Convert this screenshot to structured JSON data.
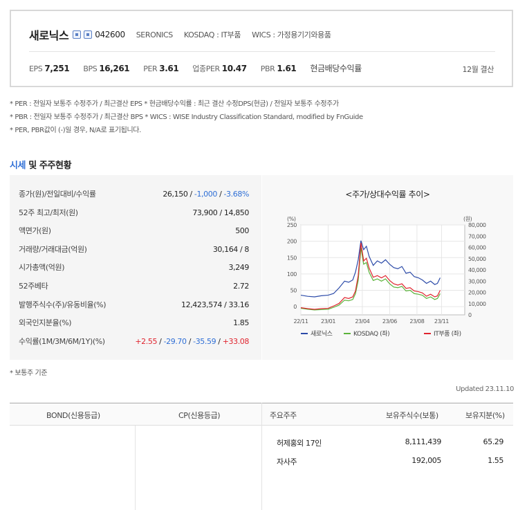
{
  "company": {
    "name": "새로닉스",
    "code": "042600",
    "english_name": "SERONICS",
    "market": "KOSDAQ : IT부품",
    "wics": "WICS : 가정용기기와용품",
    "ratios": [
      {
        "label": "EPS",
        "value": "7,251"
      },
      {
        "label": "BPS",
        "value": "16,261"
      },
      {
        "label": "PER",
        "value": "3.61"
      },
      {
        "label": "업종PER",
        "value": "10.47"
      },
      {
        "label": "PBR",
        "value": "1.61"
      }
    ],
    "cash_dividend_label": "현금배당수익률",
    "fiscal": "12월 결산"
  },
  "notes": [
    "* PER : 전일자 보통주 수정주가 / 최근결산 EPS * 현금배당수익률 : 최근 결산 수정DPS(현금) / 전일자 보통주 수정주가",
    "* PBR : 전일자 보통주 수정주가 / 최근결산 BPS * WICS : WISE Industry Classification Standard, modified by FnGuide",
    "* PER, PBR값이 (-)일 경우, N/A로 표기됩니다."
  ],
  "section": {
    "accent": "시세",
    "rest": " 및 주주현황"
  },
  "price_rows": [
    {
      "label": "종가(원)/전일대비/수익률",
      "v1": "26,150",
      "v2": "-1,000",
      "v3": "-3.68%"
    },
    {
      "label": "52주 최고/최저(원)",
      "value": "73,900 / 14,850"
    },
    {
      "label": "액면가(원)",
      "value": "500"
    },
    {
      "label": "거래량/거래대금(억원)",
      "value": "30,164 / 8"
    },
    {
      "label": "시가총액(억원)",
      "value": "3,249"
    },
    {
      "label": "52주베타",
      "value": "2.72"
    },
    {
      "label": "발행주식수(주)/유동비율(%)",
      "value": "12,423,574 / 33.16"
    },
    {
      "label": "외국인지분율(%)",
      "value": "1.85"
    },
    {
      "label": "수익률(1M/3M/6M/1Y)(%)",
      "r1": "+2.55",
      "r2": "-29.70",
      "r3": "-35.59",
      "r4": "+33.08"
    }
  ],
  "basis_note": "* 보통주 기준",
  "updated": "Updated 23.11.10",
  "bottom": {
    "bond_label": "BOND(신용등급)",
    "cp_label": "CP(신용등급)",
    "holder_label": "주요주주",
    "shares_label": "보유주식수(보통)",
    "ratio_label": "보유지분(%)",
    "holders": [
      {
        "name": "허제홍외 17인",
        "shares": "8,111,439",
        "ratio": "65.29"
      },
      {
        "name": "자사주",
        "shares": "192,005",
        "ratio": "1.55"
      }
    ]
  },
  "chart_data": {
    "type": "line",
    "title": "<주가/상대수익률 추이>",
    "left_unit": "(%)",
    "right_unit": "(원)",
    "x_ticks": [
      "22/11",
      "23/01",
      "23/04",
      "23/06",
      "23/08",
      "23/11"
    ],
    "x_range": [
      0,
      12
    ],
    "x_tick_positions": [
      0,
      2,
      4.5,
      6.5,
      8.5,
      10.3
    ],
    "y_left_ticks": [
      0,
      50,
      100,
      150,
      200,
      250
    ],
    "y_left_range": [
      -25,
      250
    ],
    "y_right_ticks": [
      "0",
      "10,000",
      "20,000",
      "30,000",
      "40,000",
      "50,000",
      "60,000",
      "70,000",
      "80,000"
    ],
    "y_right_range": [
      0,
      80000
    ],
    "series": [
      {
        "name": "새로닉스",
        "color": "#2b4aa8",
        "axis": "right",
        "x": [
          0,
          0.5,
          1,
          1.5,
          2,
          2.4,
          2.8,
          3.2,
          3.5,
          3.8,
          4,
          4.2,
          4.4,
          4.6,
          4.8,
          5,
          5.3,
          5.6,
          5.9,
          6.2,
          6.5,
          6.8,
          7.1,
          7.4,
          7.7,
          8,
          8.3,
          8.6,
          8.9,
          9.2,
          9.5,
          9.8,
          10,
          10.2
        ],
        "y": [
          17500,
          16500,
          16000,
          17000,
          17500,
          19000,
          24000,
          30000,
          29000,
          31000,
          38000,
          49000,
          66000,
          58000,
          61000,
          52000,
          44000,
          48000,
          46000,
          49000,
          45000,
          42000,
          41000,
          43000,
          37000,
          38000,
          34000,
          33000,
          31000,
          28000,
          30000,
          27000,
          28000,
          33000
        ]
      },
      {
        "name": "KOSDAQ (좌)",
        "color": "#5ab33a",
        "axis": "left",
        "x": [
          0,
          0.5,
          1,
          1.5,
          2,
          2.4,
          2.8,
          3.2,
          3.5,
          3.8,
          4,
          4.2,
          4.4,
          4.6,
          4.8,
          5,
          5.3,
          5.6,
          5.9,
          6.2,
          6.5,
          6.8,
          7.1,
          7.4,
          7.7,
          8,
          8.3,
          8.6,
          8.9,
          9.2,
          9.5,
          9.8,
          10,
          10.2
        ],
        "y": [
          -5,
          -8,
          -10,
          -9,
          -8,
          -2,
          5,
          20,
          18,
          22,
          40,
          80,
          180,
          130,
          135,
          105,
          80,
          85,
          78,
          85,
          70,
          60,
          58,
          62,
          48,
          50,
          40,
          38,
          35,
          25,
          30,
          22,
          25,
          40
        ]
      },
      {
        "name": "IT부품 (좌)",
        "color": "#e0242e",
        "axis": "left",
        "x": [
          0,
          0.5,
          1,
          1.5,
          2,
          2.4,
          2.8,
          3.2,
          3.5,
          3.8,
          4,
          4.2,
          4.4,
          4.6,
          4.8,
          5,
          5.3,
          5.6,
          5.9,
          6.2,
          6.5,
          6.8,
          7.1,
          7.4,
          7.7,
          8,
          8.3,
          8.6,
          8.9,
          9.2,
          9.5,
          9.8,
          10,
          10.2
        ],
        "y": [
          -3,
          -6,
          -8,
          -6,
          -5,
          2,
          10,
          28,
          25,
          30,
          48,
          95,
          195,
          140,
          148,
          118,
          90,
          95,
          88,
          95,
          80,
          70,
          66,
          70,
          56,
          58,
          48,
          46,
          42,
          32,
          38,
          30,
          33,
          50
        ]
      }
    ],
    "legend_position": "bottom",
    "grid": true
  }
}
